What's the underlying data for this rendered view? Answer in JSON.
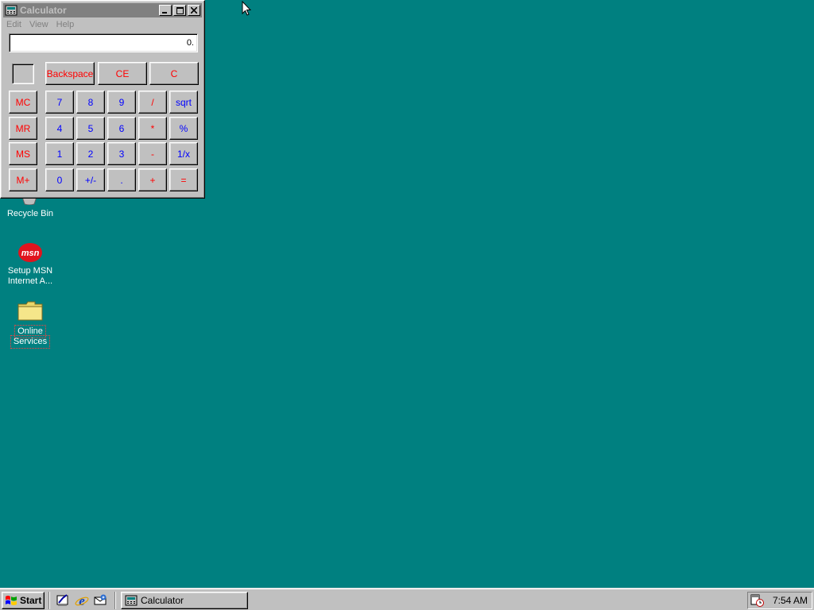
{
  "calculator": {
    "title": "Calculator",
    "menu": [
      "Edit",
      "View",
      "Help"
    ],
    "display_value": "0.",
    "top_buttons": [
      "Backspace",
      "CE",
      "C"
    ],
    "memory_buttons": [
      "MC",
      "MR",
      "MS",
      "M+"
    ],
    "keypad": [
      [
        "7",
        "8",
        "9",
        "/",
        "sqrt"
      ],
      [
        "4",
        "5",
        "6",
        "*",
        "%"
      ],
      [
        "1",
        "2",
        "3",
        "-",
        "1/x"
      ],
      [
        "0",
        "+/-",
        ".",
        "+",
        "="
      ]
    ]
  },
  "desktop": {
    "icons": [
      {
        "label_line1": "Recycle Bin",
        "label_line2": ""
      },
      {
        "label_line1": "Setup MSN",
        "label_line2": "Internet A..."
      },
      {
        "label_line1": "Online",
        "label_line2": "Services"
      }
    ],
    "msn_logo_text": "msn",
    "background_color": "#008080"
  },
  "taskbar": {
    "start_label": "Start",
    "task_calculator": "Calculator",
    "clock": "7:54 AM"
  },
  "colors": {
    "memory_ops": "#ff0000",
    "digits": "#0000ff",
    "inactive_title": "#808080"
  }
}
